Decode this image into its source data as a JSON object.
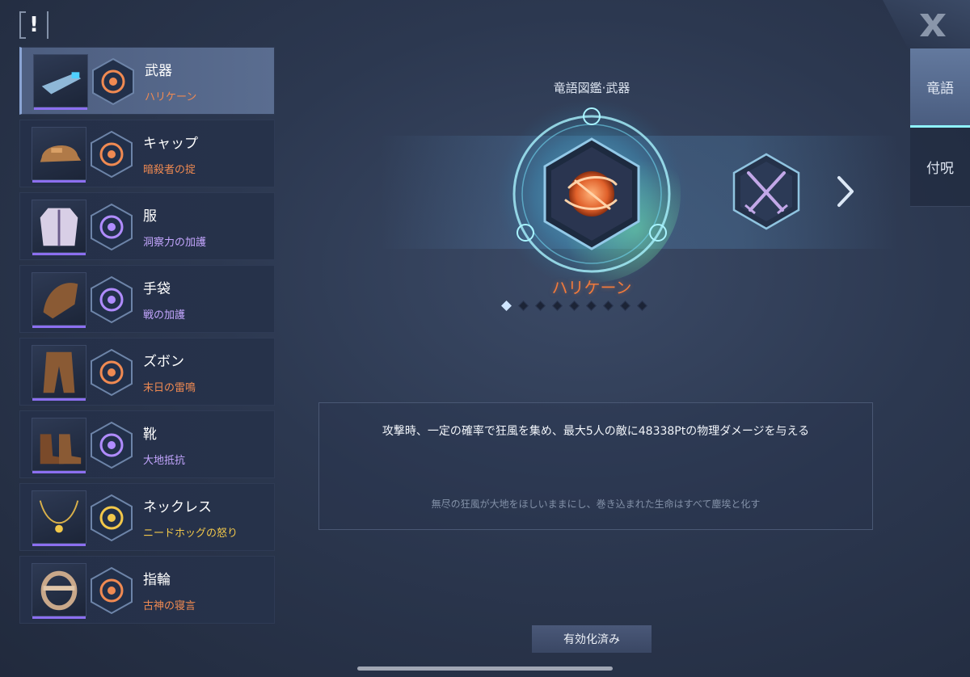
{
  "alert_icon": "!",
  "close_icon": "X",
  "colors": {
    "orange": "#f08a52",
    "purple": "#c4a6ff",
    "gold": "#f2c84a",
    "accent_cyan": "#8ff3ff"
  },
  "equipment": [
    {
      "slot": "武器",
      "name": "ハリケーン",
      "tone": "orange",
      "icon": "gun-icon",
      "selected": true
    },
    {
      "slot": "キャップ",
      "name": "暗殺者の掟",
      "tone": "orange",
      "icon": "cap-icon"
    },
    {
      "slot": "服",
      "name": "洞察力の加護",
      "tone": "purple",
      "icon": "jacket-icon"
    },
    {
      "slot": "手袋",
      "name": "戦の加護",
      "tone": "purple",
      "icon": "glove-icon"
    },
    {
      "slot": "ズボン",
      "name": "末日の雷鳴",
      "tone": "orange",
      "icon": "pants-icon"
    },
    {
      "slot": "靴",
      "name": "大地抵抗",
      "tone": "purple",
      "icon": "boots-icon"
    },
    {
      "slot": "ネックレス",
      "name": "ニードホッグの怒り",
      "tone": "gold",
      "icon": "necklace-icon"
    },
    {
      "slot": "指輪",
      "name": "古神の寝言",
      "tone": "orange",
      "icon": "ring-icon"
    }
  ],
  "tabs": [
    "竜語",
    "付呪"
  ],
  "detail": {
    "title": "竜語図鑑·武器",
    "name": "ハリケーン",
    "page_count": 9,
    "page_active": 1,
    "description": "攻撃時、一定の確率で狂風を集め、最大5人の敵に48338Ptの物理ダメージを与える",
    "flavor": "無尽の狂風が大地をほしいままにし、巻き込まれた生命はすべて塵埃と化す",
    "status_button": "有効化済み"
  }
}
